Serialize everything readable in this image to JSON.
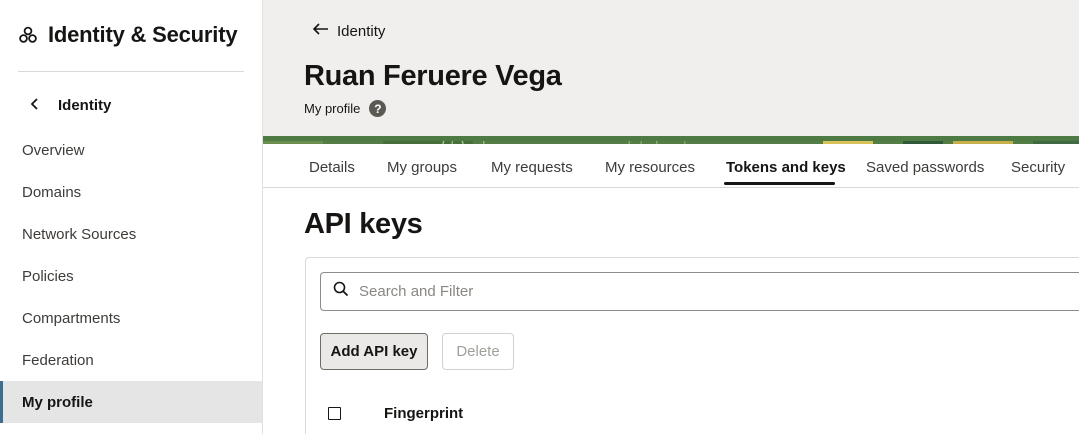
{
  "sidebar": {
    "title": "Identity & Security",
    "back_label": "Identity",
    "items": [
      {
        "label": "Overview"
      },
      {
        "label": "Domains"
      },
      {
        "label": "Network Sources"
      },
      {
        "label": "Policies"
      },
      {
        "label": "Compartments"
      },
      {
        "label": "Federation"
      },
      {
        "label": "My profile"
      }
    ],
    "active_item": "My profile"
  },
  "header": {
    "breadcrumb": "Identity",
    "title": "Ruan Feruere Vega",
    "subtitle": "My profile",
    "help_icon": "?"
  },
  "tabs": [
    {
      "label": "Details"
    },
    {
      "label": "My groups"
    },
    {
      "label": "My requests"
    },
    {
      "label": "My resources"
    },
    {
      "label": "Tokens and keys"
    },
    {
      "label": "Saved passwords"
    },
    {
      "label": "Security"
    }
  ],
  "active_tab": "Tokens and keys",
  "content": {
    "section_title": "API keys",
    "search_placeholder": "Search and Filter",
    "add_button": "Add API key",
    "delete_button": "Delete",
    "columns": [
      "Fingerprint"
    ]
  },
  "colors": {
    "accent": "#3b6e8f",
    "header_bg": "#f1efed",
    "active_nav_bg": "#e5e5e5"
  }
}
